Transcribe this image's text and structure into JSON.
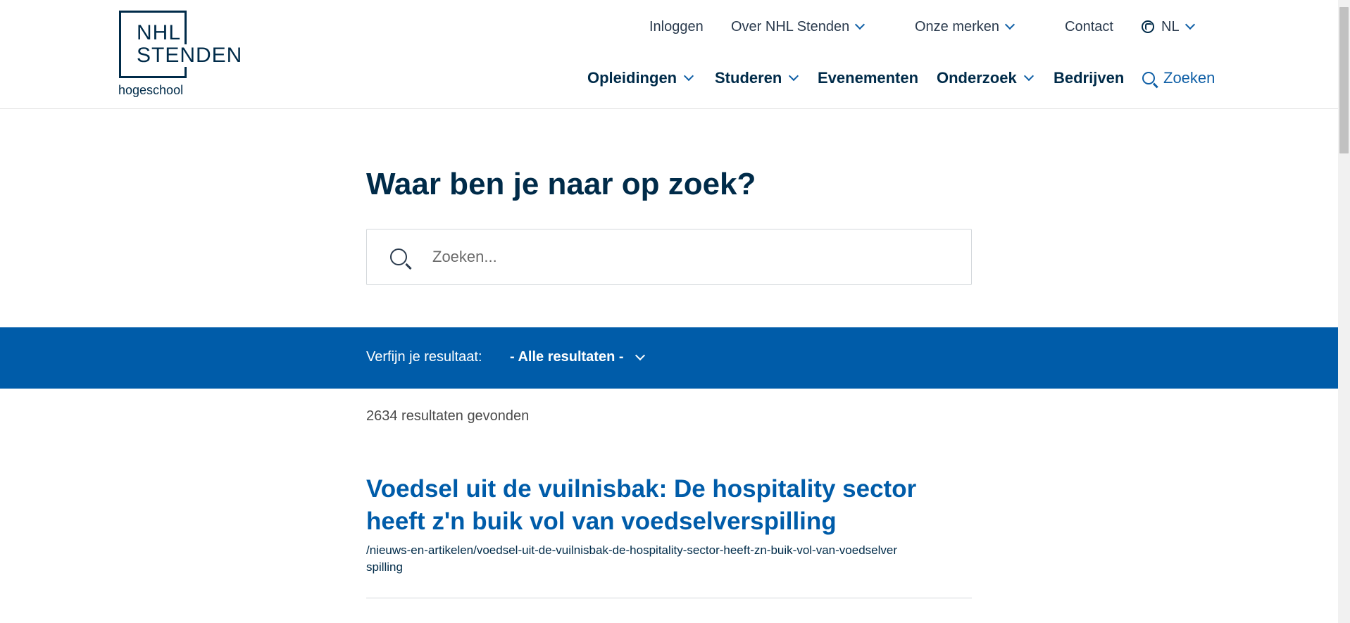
{
  "logo": {
    "line1": "NHL",
    "line2": "STENDEN",
    "line3": "hogeschool"
  },
  "topnav": {
    "login": "Inloggen",
    "about": "Over NHL Stenden",
    "brands": "Onze merken",
    "contact": "Contact",
    "language": "NL"
  },
  "mainnav": {
    "items": [
      "Opleidingen",
      "Studeren",
      "Evenementen",
      "Onderzoek",
      "Bedrijven"
    ],
    "search": "Zoeken"
  },
  "search": {
    "heading": "Waar ben je naar op zoek?",
    "placeholder": "Zoeken...",
    "value": ""
  },
  "filter": {
    "label": "Verfijn je resultaat:",
    "selected": "- Alle resultaten -"
  },
  "results": {
    "count_text": "2634 resultaten gevonden",
    "items": [
      {
        "title": "Voedsel uit de vuilnisbak: De hospitality sector heeft z'n buik vol van voedselverspilling",
        "url": "/nieuws-en-artikelen/voedsel-uit-de-vuilnisbak-de-hospitality-sector-heeft-zn-buik-vol-van-voedselverspilling"
      }
    ]
  },
  "colors": {
    "primary": "#005ca9",
    "navy": "#002b49",
    "link": "#0f5fa6"
  },
  "icons": {
    "search": "search-icon",
    "globe": "globe-icon",
    "chevron": "chevron-down-icon"
  }
}
